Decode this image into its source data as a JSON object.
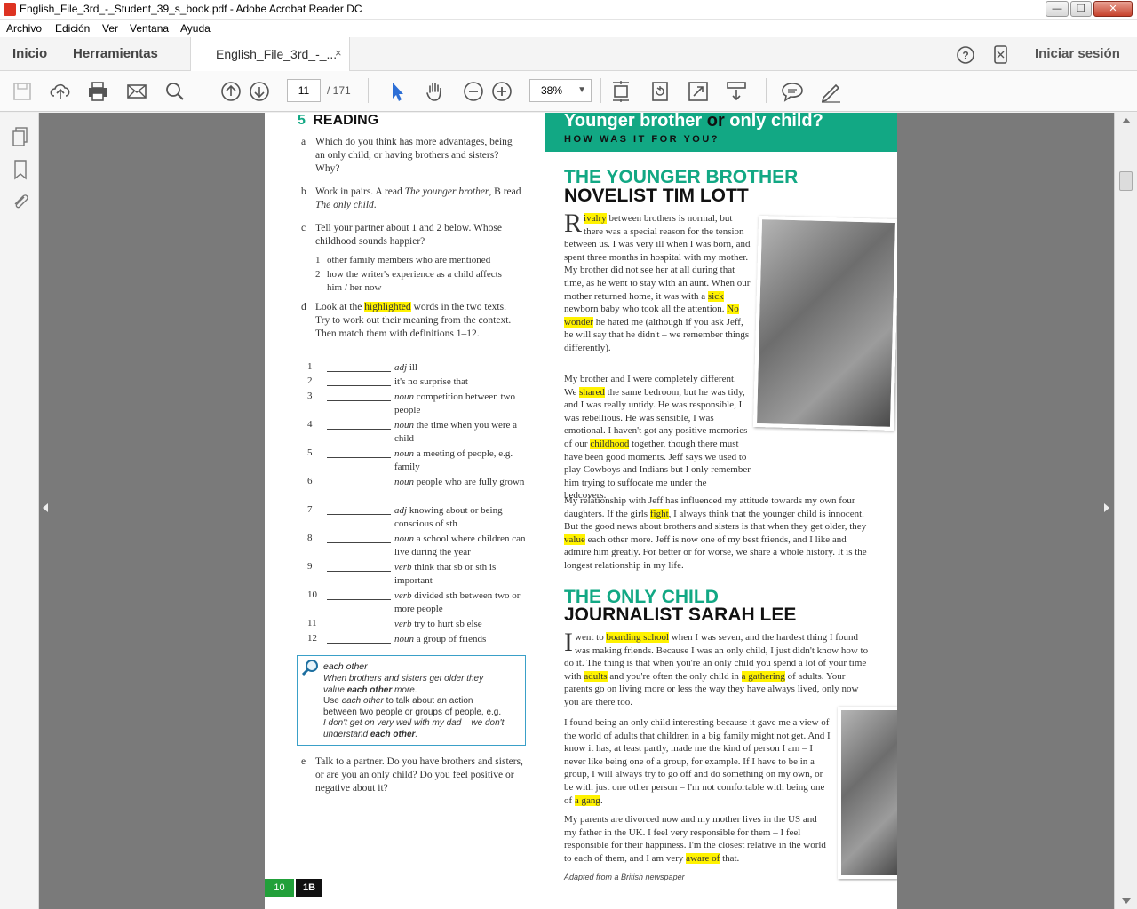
{
  "window": {
    "title": "English_File_3rd_-_Student_39_s_book.pdf - Adobe Acrobat Reader DC",
    "controls": {
      "minimize": "—",
      "maximize": "❐",
      "close": "✕"
    }
  },
  "menu": [
    "Archivo",
    "Edición",
    "Ver",
    "Ventana",
    "Ayuda"
  ],
  "tabs": {
    "home": "Inicio",
    "tools": "Herramientas",
    "document": "English_File_3rd_-_...",
    "close": "×",
    "help_icon": "?",
    "signin": "Iniciar sesión"
  },
  "toolbar": {
    "page_current": "11",
    "page_total": "/ 171",
    "zoom": "38%",
    "zoom_dropdown": "▼",
    "icons": [
      "save-icon",
      "upload-icon",
      "print-icon",
      "email-icon",
      "search-icon",
      "prev-page-icon",
      "next-page-icon",
      "select-cursor-icon",
      "hand-icon",
      "zoom-out-icon",
      "zoom-in-icon",
      "fit-page-icon",
      "rotate-icon",
      "fullscreen-icon",
      "scroll-mode-icon",
      "comment-icon",
      "sign-icon"
    ]
  },
  "accent": "#12a884",
  "highlight": "#fff200",
  "left_page": {
    "section_number": "5",
    "section_title": "READING",
    "a_key": "a",
    "a_text": "Which do you think has more advantages, being an only child, or having brothers and sisters? Why?",
    "b_key": "b",
    "b_text_1": "Work in pairs. A read ",
    "b_text_2": "The younger brother",
    "b_text_3": ", B read ",
    "b_text_4": "The only child",
    "b_text_5": ".",
    "c_key": "c",
    "c_text": "Tell your partner about 1 and 2 below. Whose childhood sounds happier?",
    "c_items": [
      {
        "n": "1",
        "text": "other family members who are mentioned"
      },
      {
        "n": "2",
        "text": "how the writer's experience as a child affects him / her now"
      }
    ],
    "d_key": "d",
    "d_text_1": "Look at the ",
    "d_text_hl": "highlighted",
    "d_text_2": " words in the two texts. Try to work out their meaning from the context. Then match them with definitions 1–12.",
    "definitions": [
      {
        "n": "1",
        "pos": "adj",
        "text": "ill"
      },
      {
        "n": "2",
        "pos": "",
        "text": "it's no surprise that"
      },
      {
        "n": "3",
        "pos": "noun",
        "text": "competition between two people"
      },
      {
        "n": "4",
        "pos": "noun",
        "text": "the time when you were a child"
      },
      {
        "n": "5",
        "pos": "noun",
        "text": "a meeting of people, e.g. family"
      },
      {
        "n": "6",
        "pos": "noun",
        "text": "people who are fully grown"
      },
      {
        "n": "7",
        "pos": "adj",
        "text": "knowing about or being conscious of sth"
      },
      {
        "n": "8",
        "pos": "noun",
        "text": "a school where children can live during the year"
      },
      {
        "n": "9",
        "pos": "verb",
        "text": "think that sb or sth is important"
      },
      {
        "n": "10",
        "pos": "verb",
        "text": "divided sth between two or more people"
      },
      {
        "n": "11",
        "pos": "verb",
        "text": "try to hurt sb else"
      },
      {
        "n": "12",
        "pos": "noun",
        "text": "a group of friends"
      }
    ],
    "tip": {
      "title": "each other",
      "line1": "When brothers and sisters get older they",
      "line2_a": "value ",
      "line2_b": "each other",
      "line2_c": " more.",
      "line3_a": "Use ",
      "line3_b": "each other",
      "line3_c": " to talk about an action",
      "line4": "between two people or groups of people, e.g.",
      "line5": "I don't get on very well with my dad – we don't",
      "line6_a": "understand ",
      "line6_b": "each other",
      "line6_c": "."
    },
    "e_key": "e",
    "e_text": "Talk to a partner. Do you have brothers and sisters, or are you an only child? Do you feel positive or negative about it?",
    "footer_page": "10",
    "footer_unit": "1B"
  },
  "right_page": {
    "banner_title_1": "Younger brother ",
    "banner_title_or": "or",
    "banner_title_2": " only child?",
    "banner_subtitle": "HOW WAS IT FOR YOU?",
    "h1_green": "THE YOUNGER BROTHER",
    "h1_black": "NOVELIST TIM LOTT",
    "p1_drop": "R",
    "p1_hl_rivalry": "ivalry",
    "p1_a": " between brothers is normal, but there was a special reason for the tension between us. I was very ill when I was born, and spent three months in hospital with my mother. My brother did not see her at all during that time, as he went to stay with an aunt. When our mother returned home, it was with a ",
    "p1_hl_sick": "sick",
    "p1_b": " newborn baby who took all the attention. ",
    "p1_hl_nowonder": "No wonder",
    "p1_c": " he hated me (although if you ask Jeff, he will say that he didn't – we remember things differently).",
    "p2_a": "My brother and I were completely different. We ",
    "p2_hl_shared": "shared",
    "p2_b": " the same bedroom, but he was tidy, and I was really untidy. He was responsible, I was rebellious. He was sensible, I was emotional. I haven't got any positive memories of our ",
    "p2_hl_childhood": "childhood",
    "p2_c": " together, though there must have been good moments. Jeff says we used to play Cowboys and Indians but I only remember him trying to suffocate me under the bedcovers.",
    "p3_a": "My relationship with Jeff has influenced my attitude towards my own four daughters. If the girls ",
    "p3_hl_fight": "fight",
    "p3_b": ", I always think that the younger child is innocent. But the good news about brothers and sisters is that when they get older, they ",
    "p3_hl_value": "value",
    "p3_c": " each other more. Jeff is now one of my best friends, and I like and admire him greatly. For better or for worse, we share a whole history. It is the longest relationship in my life.",
    "h2_green": "THE ONLY CHILD",
    "h2_black": "JOURNALIST SARAH LEE",
    "p4_drop": "I",
    "p4_a": " went to ",
    "p4_hl_boarding": "boarding school",
    "p4_b": " when I was seven, and the hardest thing I found was making friends. Because I was an only child, I just didn't know how to do it. The thing is that when you're an only child you spend a lot of your time with ",
    "p4_hl_adults": "adults",
    "p4_c": " and you're often the only child in ",
    "p4_hl_gathering": "a gathering",
    "p4_d": " of adults. Your parents go on living more or less the way they have always lived, only now you are there too.",
    "p5_a": "I found being an only child interesting because it gave me a view of the world of adults that children in a big family might not get. And I know it has, at least partly, made me the kind of person I am – I never like being one of a group, for example. If I have to be in a group, I will always try to go off and do something on my own, or be with just one other person – I'm not comfortable with being one of ",
    "p5_hl_gang": "a gang",
    "p5_b": ".",
    "p6_a": "My parents are divorced now and my mother lives in the US and my father in the UK. I feel very responsible for them – I feel responsible for their happiness. I'm the closest relative in the world to each of them, and I am very ",
    "p6_hl_aware": "aware of",
    "p6_b": " that.",
    "source": "Adapted from a British newspaper"
  }
}
